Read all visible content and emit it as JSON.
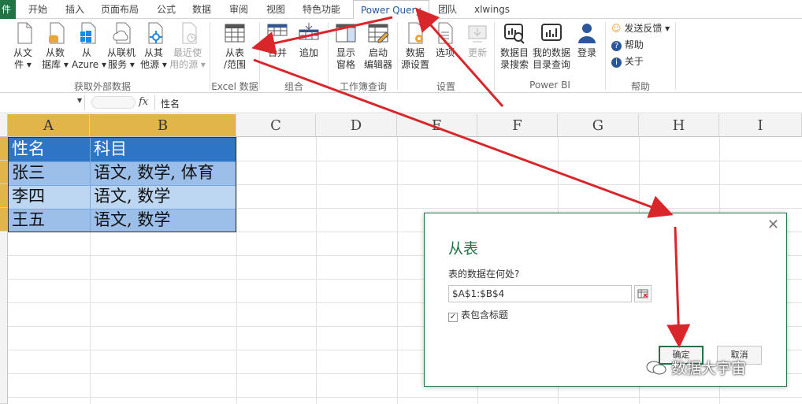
{
  "tabs": {
    "file": "件",
    "items": [
      "开始",
      "插入",
      "页面布局",
      "公式",
      "数据",
      "审阅",
      "视图",
      "特色功能",
      "Power Query",
      "团队",
      "xlwings"
    ],
    "active": "Power Query"
  },
  "ribbon": {
    "groups": {
      "external": "获取外部数据",
      "excel": "Excel 数据",
      "combine": "组合",
      "workbook": "工作簿查询",
      "settings": "设置",
      "powerbi": "Power BI",
      "help": "帮助"
    },
    "buttons": {
      "from_file": [
        "从文",
        "件 ▾"
      ],
      "from_db": [
        "从数",
        "据库 ▾"
      ],
      "from_azure": [
        "从",
        "Azure ▾"
      ],
      "from_online": [
        "从联机",
        "服务 ▾"
      ],
      "from_other": [
        "从其",
        "他源 ▾"
      ],
      "recent": [
        "最近使",
        "用的源 ▾"
      ],
      "from_table": [
        "从表",
        "/范围"
      ],
      "merge": "合并",
      "append": "追加",
      "show_pane": [
        "显示",
        "窗格"
      ],
      "launch_editor": [
        "启动",
        "编辑器"
      ],
      "data_source": [
        "数据",
        "源设置"
      ],
      "options": "选项",
      "update": "更新",
      "catalog_search": [
        "数据目",
        "录搜索"
      ],
      "my_catalog": [
        "我的数据",
        "目录查询"
      ],
      "login": "登录",
      "feedback": "发送反馈 ▾",
      "help": "帮助",
      "about": "关于"
    }
  },
  "formula_bar": {
    "fx": "fx",
    "content": "性名"
  },
  "sheet": {
    "columns": [
      "A",
      "B",
      "C",
      "D",
      "E",
      "F",
      "G",
      "H",
      "I"
    ],
    "rows": [
      [
        "性名",
        "科目"
      ],
      [
        "张三",
        "语文, 数学, 体育"
      ],
      [
        "李四",
        "语文, 数学"
      ],
      [
        "王五",
        "语文, 数学"
      ]
    ],
    "colors": {
      "header_fill": "#2f75c5",
      "row_fill_dark": "#9bbfe9",
      "row_fill_light": "#bdd7f2",
      "selection": "#e2b54a"
    }
  },
  "dialog": {
    "title": "从表",
    "prompt": "表的数据在何处?",
    "range": "$A$1:$B$4",
    "checkbox_label": "表包含标题",
    "checkbox_checked": "✓",
    "ok": "确定",
    "cancel": "取消",
    "close": "✕"
  },
  "watermark": "数据大宇宙",
  "annotation_color": "#d9262b"
}
